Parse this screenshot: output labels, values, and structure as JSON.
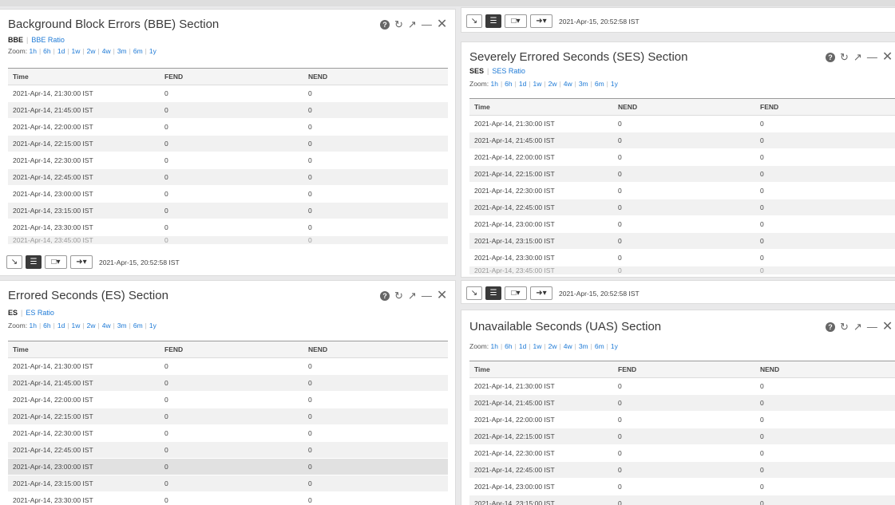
{
  "toolbar_time": "2021-Apr-15, 20:52:58 IST",
  "zoom": {
    "label": "Zoom:",
    "options": [
      "1h",
      "6h",
      "1d",
      "1w",
      "2w",
      "4w",
      "3m",
      "6m",
      "1y"
    ]
  },
  "icons": [
    "help-icon",
    "refresh-icon",
    "popout-icon",
    "minimize-icon",
    "close-icon",
    "chart-view-icon",
    "table-view-icon",
    "chart-type-icon",
    "export-icon"
  ],
  "panels": {
    "bbe": {
      "title": "Background Block Errors (BBE) Section",
      "tab_active": "BBE",
      "tab_other": "BBE Ratio",
      "headers": [
        "Time",
        "FEND",
        "NEND"
      ],
      "rows": [
        [
          "2021-Apr-14, 21:30:00 IST",
          "0",
          "0"
        ],
        [
          "2021-Apr-14, 21:45:00 IST",
          "0",
          "0"
        ],
        [
          "2021-Apr-14, 22:00:00 IST",
          "0",
          "0"
        ],
        [
          "2021-Apr-14, 22:15:00 IST",
          "0",
          "0"
        ],
        [
          "2021-Apr-14, 22:30:00 IST",
          "0",
          "0"
        ],
        [
          "2021-Apr-14, 22:45:00 IST",
          "0",
          "0"
        ],
        [
          "2021-Apr-14, 23:00:00 IST",
          "0",
          "0"
        ],
        [
          "2021-Apr-14, 23:15:00 IST",
          "0",
          "0"
        ],
        [
          "2021-Apr-14, 23:30:00 IST",
          "0",
          "0"
        ],
        [
          "2021-Apr-14, 23:45:00 IST",
          "0",
          "0"
        ]
      ]
    },
    "es": {
      "title": "Errored Seconds (ES) Section",
      "tab_active": "ES",
      "tab_other": "ES Ratio",
      "headers": [
        "Time",
        "FEND",
        "NEND"
      ],
      "rows": [
        [
          "2021-Apr-14, 21:30:00 IST",
          "0",
          "0"
        ],
        [
          "2021-Apr-14, 21:45:00 IST",
          "0",
          "0"
        ],
        [
          "2021-Apr-14, 22:00:00 IST",
          "0",
          "0"
        ],
        [
          "2021-Apr-14, 22:15:00 IST",
          "0",
          "0"
        ],
        [
          "2021-Apr-14, 22:30:00 IST",
          "0",
          "0"
        ],
        [
          "2021-Apr-14, 22:45:00 IST",
          "0",
          "0"
        ],
        [
          "2021-Apr-14, 23:00:00 IST",
          "0",
          "0"
        ],
        [
          "2021-Apr-14, 23:15:00 IST",
          "0",
          "0"
        ],
        [
          "2021-Apr-14, 23:30:00 IST",
          "0",
          "0"
        ]
      ]
    },
    "ses": {
      "title": "Severely Errored Seconds (SES) Section",
      "tab_active": "SES",
      "tab_other": "SES Ratio",
      "headers": [
        "Time",
        "NEND",
        "FEND"
      ],
      "rows": [
        [
          "2021-Apr-14, 21:30:00 IST",
          "0",
          "0"
        ],
        [
          "2021-Apr-14, 21:45:00 IST",
          "0",
          "0"
        ],
        [
          "2021-Apr-14, 22:00:00 IST",
          "0",
          "0"
        ],
        [
          "2021-Apr-14, 22:15:00 IST",
          "0",
          "0"
        ],
        [
          "2021-Apr-14, 22:30:00 IST",
          "0",
          "0"
        ],
        [
          "2021-Apr-14, 22:45:00 IST",
          "0",
          "0"
        ],
        [
          "2021-Apr-14, 23:00:00 IST",
          "0",
          "0"
        ],
        [
          "2021-Apr-14, 23:15:00 IST",
          "0",
          "0"
        ],
        [
          "2021-Apr-14, 23:30:00 IST",
          "0",
          "0"
        ],
        [
          "2021-Apr-14, 23:45:00 IST",
          "0",
          "0"
        ]
      ]
    },
    "uas": {
      "title": "Unavailable Seconds (UAS) Section",
      "headers": [
        "Time",
        "FEND",
        "NEND"
      ],
      "rows": [
        [
          "2021-Apr-14, 21:30:00 IST",
          "0",
          "0"
        ],
        [
          "2021-Apr-14, 21:45:00 IST",
          "0",
          "0"
        ],
        [
          "2021-Apr-14, 22:00:00 IST",
          "0",
          "0"
        ],
        [
          "2021-Apr-14, 22:15:00 IST",
          "0",
          "0"
        ],
        [
          "2021-Apr-14, 22:30:00 IST",
          "0",
          "0"
        ],
        [
          "2021-Apr-14, 22:45:00 IST",
          "0",
          "0"
        ],
        [
          "2021-Apr-14, 23:00:00 IST",
          "0",
          "0"
        ],
        [
          "2021-Apr-14, 23:15:00 IST",
          "0",
          "0"
        ]
      ]
    }
  }
}
